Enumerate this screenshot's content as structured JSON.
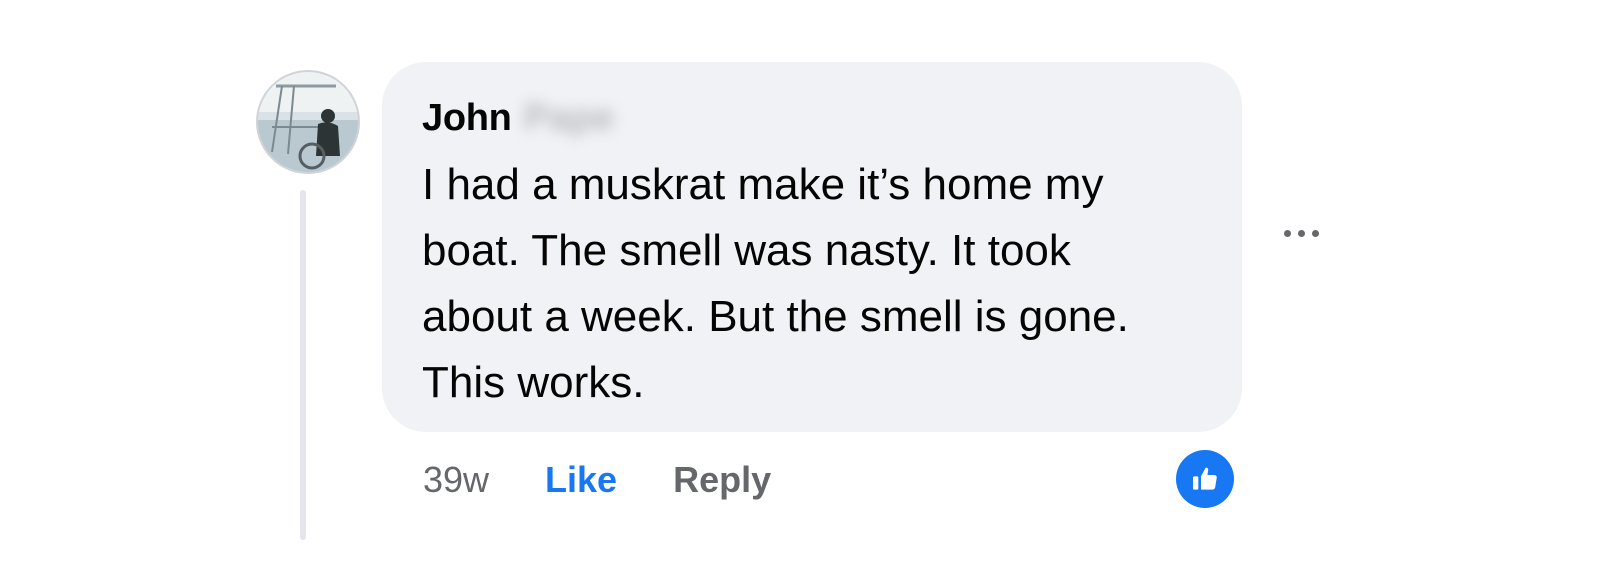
{
  "comment": {
    "author_first": "John",
    "author_last": "Pape",
    "text": "I had a muskrat make it’s home my boat. The smell was nasty. It took about a week. But the smell is gone. This works.",
    "time": "39w",
    "like_label": "Like",
    "reply_label": "Reply",
    "reaction_icon": "thumbs-up-icon",
    "more_icon": "more-options-icon",
    "colors": {
      "accent": "#1877f2",
      "bubble": "#f0f2f5",
      "muted": "#65676b",
      "text": "#050505"
    }
  }
}
